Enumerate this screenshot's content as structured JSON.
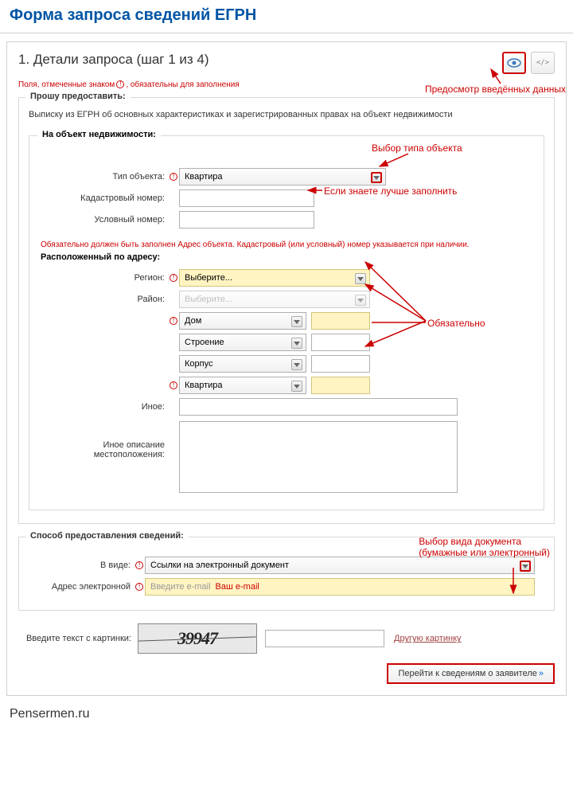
{
  "page_title": "Форма запроса сведений ЕГРН",
  "step_title": "1. Детали запроса (шаг 1 из 4)",
  "required_note_pre": "Поля, отмеченные знаком",
  "required_note_post": ", обязательны для заполнения",
  "provide": {
    "legend": "Прошу предоставить:",
    "text": "Выписку из ЕГРН об основных характеристиках и зарегистрированных правах на объект недвижимости"
  },
  "object": {
    "legend": "На объект недвижимости:",
    "type_label": "Тип объекта:",
    "type_value": "Квартира",
    "cad_label": "Кадастровый номер:",
    "cond_label": "Условный номер:",
    "warn": "Обязательно должен быть заполнен Адрес объекта. Кадастровый (или условный) номер указывается при наличии.",
    "addr_legend": "Расположенный по адресу:",
    "region_label": "Регион:",
    "region_value": "Выберите...",
    "district_label": "Район:",
    "district_value": "Выберите...",
    "house_value": "Дом",
    "building_value": "Строение",
    "korpus_value": "Корпус",
    "flat_value": "Квартира",
    "other_label": "Иное:",
    "other_desc_label": "Иное описание местоположения:"
  },
  "delivery": {
    "legend": "Способ предоставления сведений:",
    "form_label": "В виде:",
    "form_value": "Ссылки на электронный документ",
    "email_label": "Адрес электронной",
    "email_placeholder": "Введите e-mail",
    "email_hint": "Ваш e-mail"
  },
  "captcha": {
    "label": "Введите текст с картинки:",
    "code": "39947",
    "other_link": "Другую картинку"
  },
  "submit_label": "Перейти к сведениям о заявителе",
  "footer": "Pensermen.ru",
  "annotations": {
    "preview": "Предосмотр введённых данных",
    "type_select": "Выбор типа объекта",
    "cad_fill": "Если знаете лучше заполнить",
    "required": "Обязательно",
    "doc_type1": "Выбор вида документа",
    "doc_type2": "(бумажные или электронный)"
  }
}
